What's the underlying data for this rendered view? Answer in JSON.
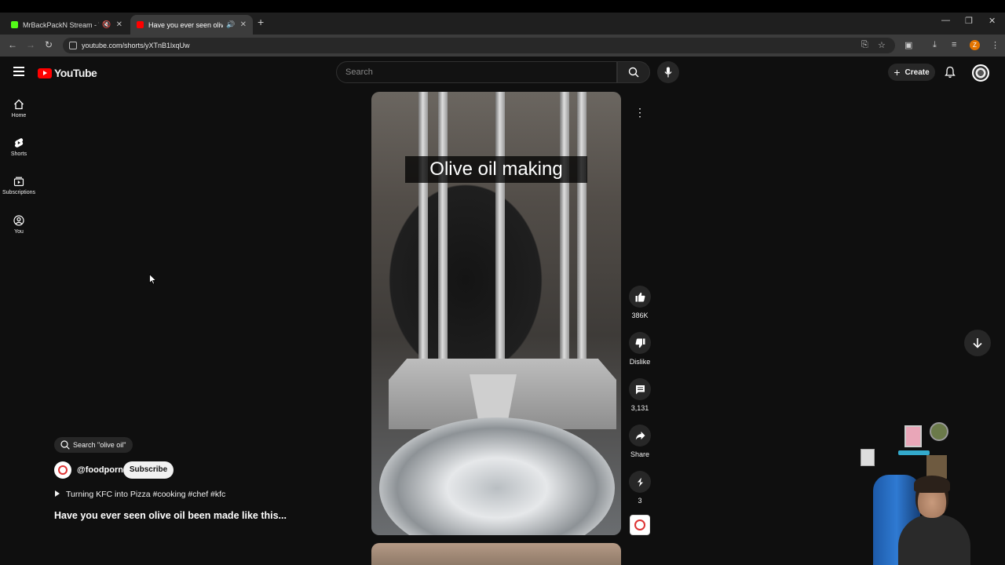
{
  "browser": {
    "tabs": [
      {
        "title": "MrBackPackN Stream - Wat",
        "favicon_color": "#53fc18"
      },
      {
        "title": "Have you ever seen olive oi",
        "favicon_color": "#ff0000"
      }
    ],
    "url": "youtube.com/shorts/yXTnB1lxqUw",
    "profile_initial": "Z"
  },
  "header": {
    "logo_text": "YouTube",
    "search_placeholder": "Search",
    "create_label": "Create"
  },
  "guide": {
    "items": [
      {
        "label": "Home",
        "icon": "home-icon"
      },
      {
        "label": "Shorts",
        "icon": "shorts-icon"
      },
      {
        "label": "Subscriptions",
        "icon": "subscriptions-icon"
      },
      {
        "label": "You",
        "icon": "you-icon"
      }
    ]
  },
  "short": {
    "caption": "Olive oil making",
    "actions": {
      "like_count": "386K",
      "dislike_label": "Dislike",
      "comment_count": "3,131",
      "share_label": "Share",
      "remix_count": "3"
    }
  },
  "meta": {
    "search_chip": "Search \"olive oil\"",
    "channel": "@foodporn",
    "subscribe_label": "Subscribe",
    "music": "Turning KFC into Pizza #cooking #chef #kfc",
    "title": "Have you ever seen olive oil been made like this..."
  },
  "colors": {
    "background": "#0f0f0f",
    "brand_red": "#ff0000",
    "chip_bg": "#272727"
  }
}
